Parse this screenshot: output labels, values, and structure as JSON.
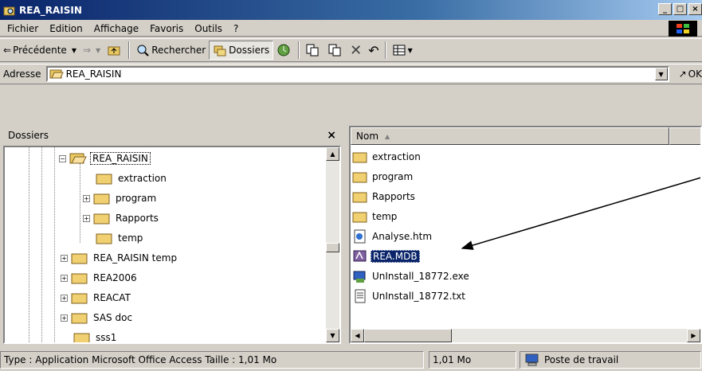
{
  "window": {
    "title": "REA_RAISIN"
  },
  "menu": [
    "Fichier",
    "Edition",
    "Affichage",
    "Favoris",
    "Outils",
    "?"
  ],
  "toolbar": {
    "back_label": "Précédente",
    "search_label": "Rechercher",
    "folders_label": "Dossiers"
  },
  "address": {
    "label": "Adresse",
    "value": "REA_RAISIN",
    "go_label": "OK"
  },
  "folders_pane": {
    "title": "Dossiers",
    "close_glyph": "×",
    "items": [
      {
        "label": "REA_RAISIN",
        "level": 3,
        "expander": "−",
        "open": true,
        "selected": true
      },
      {
        "label": "extraction",
        "level": 4,
        "expander": ""
      },
      {
        "label": "program",
        "level": 4,
        "expander": "+"
      },
      {
        "label": "Rapports",
        "level": 4,
        "expander": "+"
      },
      {
        "label": "temp",
        "level": 4,
        "expander": ""
      },
      {
        "label": "REA_RAISIN temp",
        "level": 2,
        "expander": "+"
      },
      {
        "label": "REA2006",
        "level": 2,
        "expander": "+"
      },
      {
        "label": "REACAT",
        "level": 2,
        "expander": "+"
      },
      {
        "label": "SAS doc",
        "level": 2,
        "expander": "+"
      },
      {
        "label": "sss1",
        "level": 2,
        "expander": ""
      }
    ]
  },
  "file_list": {
    "column_name": "Nom",
    "sort_glyph": "▲",
    "items": [
      {
        "label": "extraction",
        "icon": "folder-icon"
      },
      {
        "label": "program",
        "icon": "folder-icon"
      },
      {
        "label": "Rapports",
        "icon": "folder-icon"
      },
      {
        "label": "temp",
        "icon": "folder-icon"
      },
      {
        "label": "Analyse.htm",
        "icon": "html-file-icon"
      },
      {
        "label": "REA.MDB",
        "icon": "access-db-icon",
        "selected": true
      },
      {
        "label": "UnInstall_18772.exe",
        "icon": "exe-file-icon"
      },
      {
        "label": "UnInstall_18772.txt",
        "icon": "text-file-icon"
      }
    ]
  },
  "statusbar": {
    "info": "Type : Application Microsoft Office Access Taille : 1,01 Mo",
    "size": "1,01 Mo",
    "zone": "Poste de travail"
  },
  "colors": {
    "title_bar": "#0a246a",
    "selection": "#0a246a",
    "face": "#d4d0c8"
  }
}
